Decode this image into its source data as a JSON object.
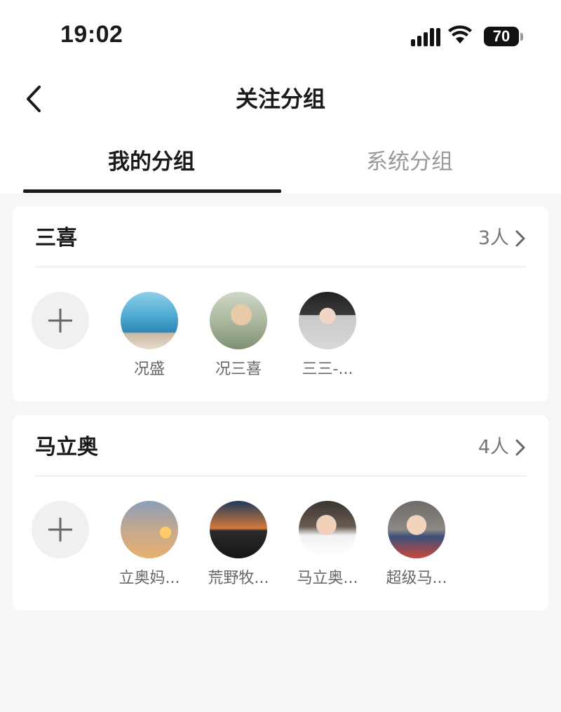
{
  "status_bar": {
    "time": "19:02",
    "battery": "70"
  },
  "nav": {
    "title": "关注分组"
  },
  "tabs": [
    {
      "label": "我的分组",
      "active": true
    },
    {
      "label": "系统分组",
      "active": false
    }
  ],
  "groups": [
    {
      "name": "三喜",
      "count": "3人",
      "members": [
        {
          "name": "况盛"
        },
        {
          "name": "况三喜"
        },
        {
          "name": "三三-..."
        }
      ]
    },
    {
      "name": "马立奥",
      "count": "4人",
      "members": [
        {
          "name": "立奥妈..."
        },
        {
          "name": "荒野牧..."
        },
        {
          "name": "马立奥..."
        },
        {
          "name": "超级马..."
        }
      ]
    }
  ],
  "colors": {
    "background": "#f6f6f6",
    "card": "#ffffff",
    "text_primary": "#1a1a1a",
    "text_secondary": "#999999"
  }
}
